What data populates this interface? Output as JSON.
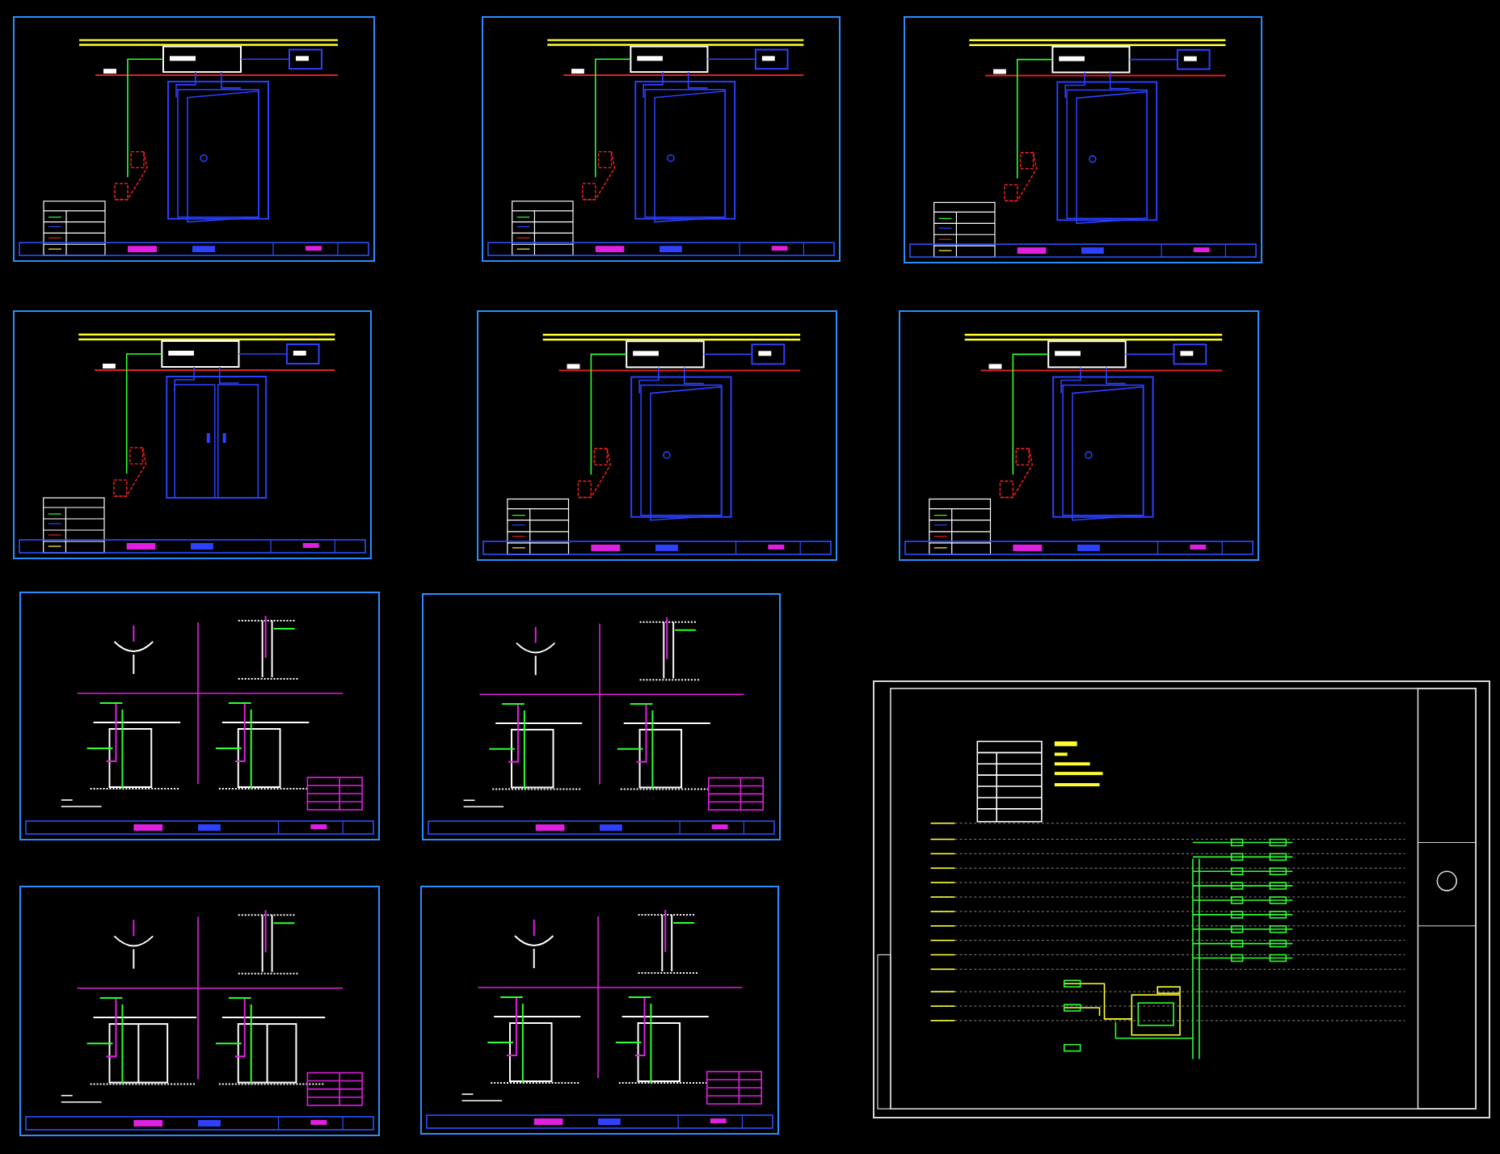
{
  "sheets": [
    {
      "kind": "door",
      "double_leaf": false
    },
    {
      "kind": "door",
      "double_leaf": false
    },
    {
      "kind": "door",
      "double_leaf": false
    },
    {
      "kind": "door",
      "double_leaf": true
    },
    {
      "kind": "door",
      "double_leaf": false
    },
    {
      "kind": "door",
      "double_leaf": false
    },
    {
      "kind": "detail",
      "double_leaf": false
    },
    {
      "kind": "detail",
      "double_leaf": false
    },
    {
      "kind": "detail",
      "double_leaf": true
    },
    {
      "kind": "detail",
      "double_leaf": false
    },
    {
      "kind": "riser"
    }
  ]
}
